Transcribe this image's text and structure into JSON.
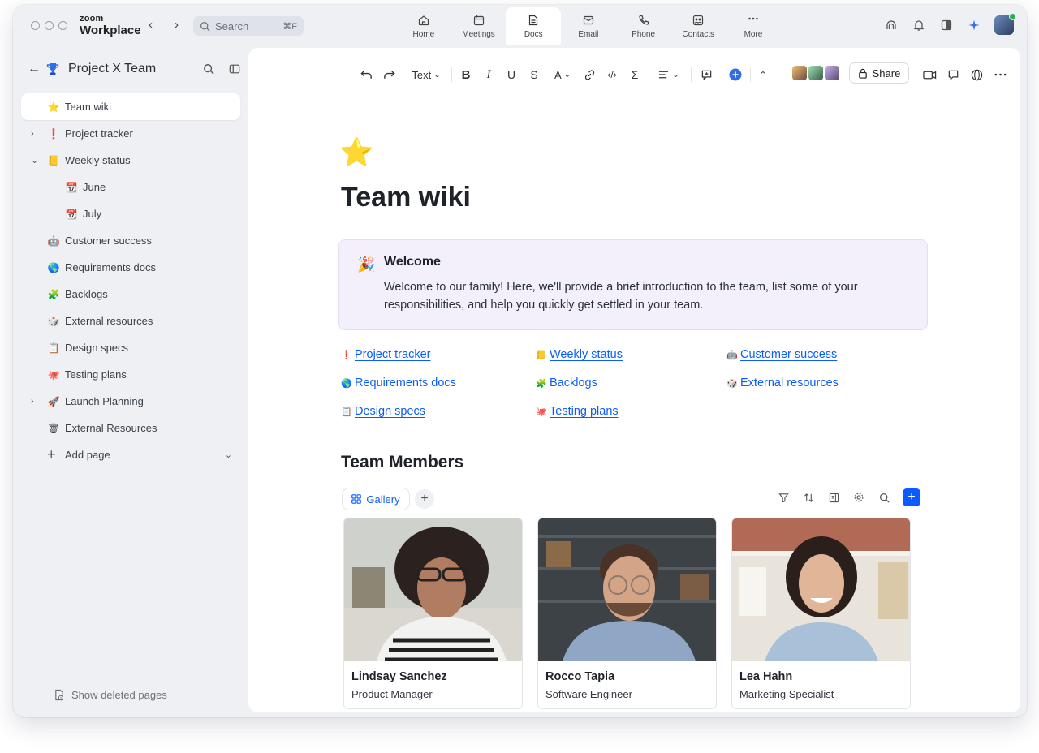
{
  "app": {
    "brand_top": "zoom",
    "brand_bottom": "Workplace"
  },
  "search": {
    "placeholder": "Search",
    "shortcut": "⌘F"
  },
  "nav_tabs": [
    {
      "label": "Home",
      "icon": "home-icon"
    },
    {
      "label": "Meetings",
      "icon": "calendar-icon"
    },
    {
      "label": "Docs",
      "icon": "doc-icon",
      "active": true
    },
    {
      "label": "Email",
      "icon": "mail-icon"
    },
    {
      "label": "Phone",
      "icon": "phone-icon"
    },
    {
      "label": "Contacts",
      "icon": "contacts-icon"
    },
    {
      "label": "More",
      "icon": "more-dots-icon"
    }
  ],
  "sidebar": {
    "title": "Project X Team",
    "items": [
      {
        "label": "Team wiki",
        "emoji": "⭐",
        "active": true
      },
      {
        "label": "Project tracker",
        "emoji": "❗",
        "chevron": "›"
      },
      {
        "label": "Weekly status",
        "emoji": "📒",
        "chevron": "⌄"
      },
      {
        "label": "June",
        "emoji": "📆",
        "sub": true
      },
      {
        "label": "July",
        "emoji": "📆",
        "sub": true
      },
      {
        "label": "Customer success",
        "emoji": "🤖"
      },
      {
        "label": "Requirements docs",
        "emoji": "🌎"
      },
      {
        "label": "Backlogs",
        "emoji": "🧩"
      },
      {
        "label": "External resources",
        "emoji": "🎲"
      },
      {
        "label": "Design specs",
        "emoji": "📋"
      },
      {
        "label": "Testing plans",
        "emoji": "🐙"
      },
      {
        "label": "Launch Planning",
        "emoji": "🚀",
        "chevron": "›"
      },
      {
        "label": "External Resources",
        "emoji": "🗑"
      }
    ],
    "add_page": "Add page",
    "show_deleted": "Show deleted pages"
  },
  "toolbar": {
    "text_style": "Text",
    "share": "Share",
    "format_letter": "A"
  },
  "doc": {
    "title": "Team wiki",
    "callout": {
      "heading": "Welcome",
      "body": "Welcome to our family! Here, we'll provide a brief introduction to the team, list some of your responsibilities, and help you quickly get settled in your team."
    },
    "links": [
      {
        "label": "Project tracker",
        "emoji": "❗"
      },
      {
        "label": "Weekly status",
        "emoji": "📒"
      },
      {
        "label": "Customer success",
        "emoji": "🤖"
      },
      {
        "label": "Requirements docs",
        "emoji": "🌎"
      },
      {
        "label": "Backlogs",
        "emoji": "🧩"
      },
      {
        "label": "External resources",
        "emoji": "🎲"
      },
      {
        "label": "Design specs",
        "emoji": "📋"
      },
      {
        "label": "Testing plans",
        "emoji": "🐙"
      }
    ],
    "section_title": "Team Members",
    "view_tab": "Gallery",
    "members": [
      {
        "name": "Lindsay Sanchez",
        "role": "Product Manager"
      },
      {
        "name": "Rocco Tapia",
        "role": "Software Engineer"
      },
      {
        "name": "Lea Hahn",
        "role": "Marketing Specialist"
      }
    ]
  },
  "colors": {
    "accent": "#0b5cff",
    "callout_bg": "#f3f0fb",
    "sidebar_bg": "#eef0f4"
  }
}
